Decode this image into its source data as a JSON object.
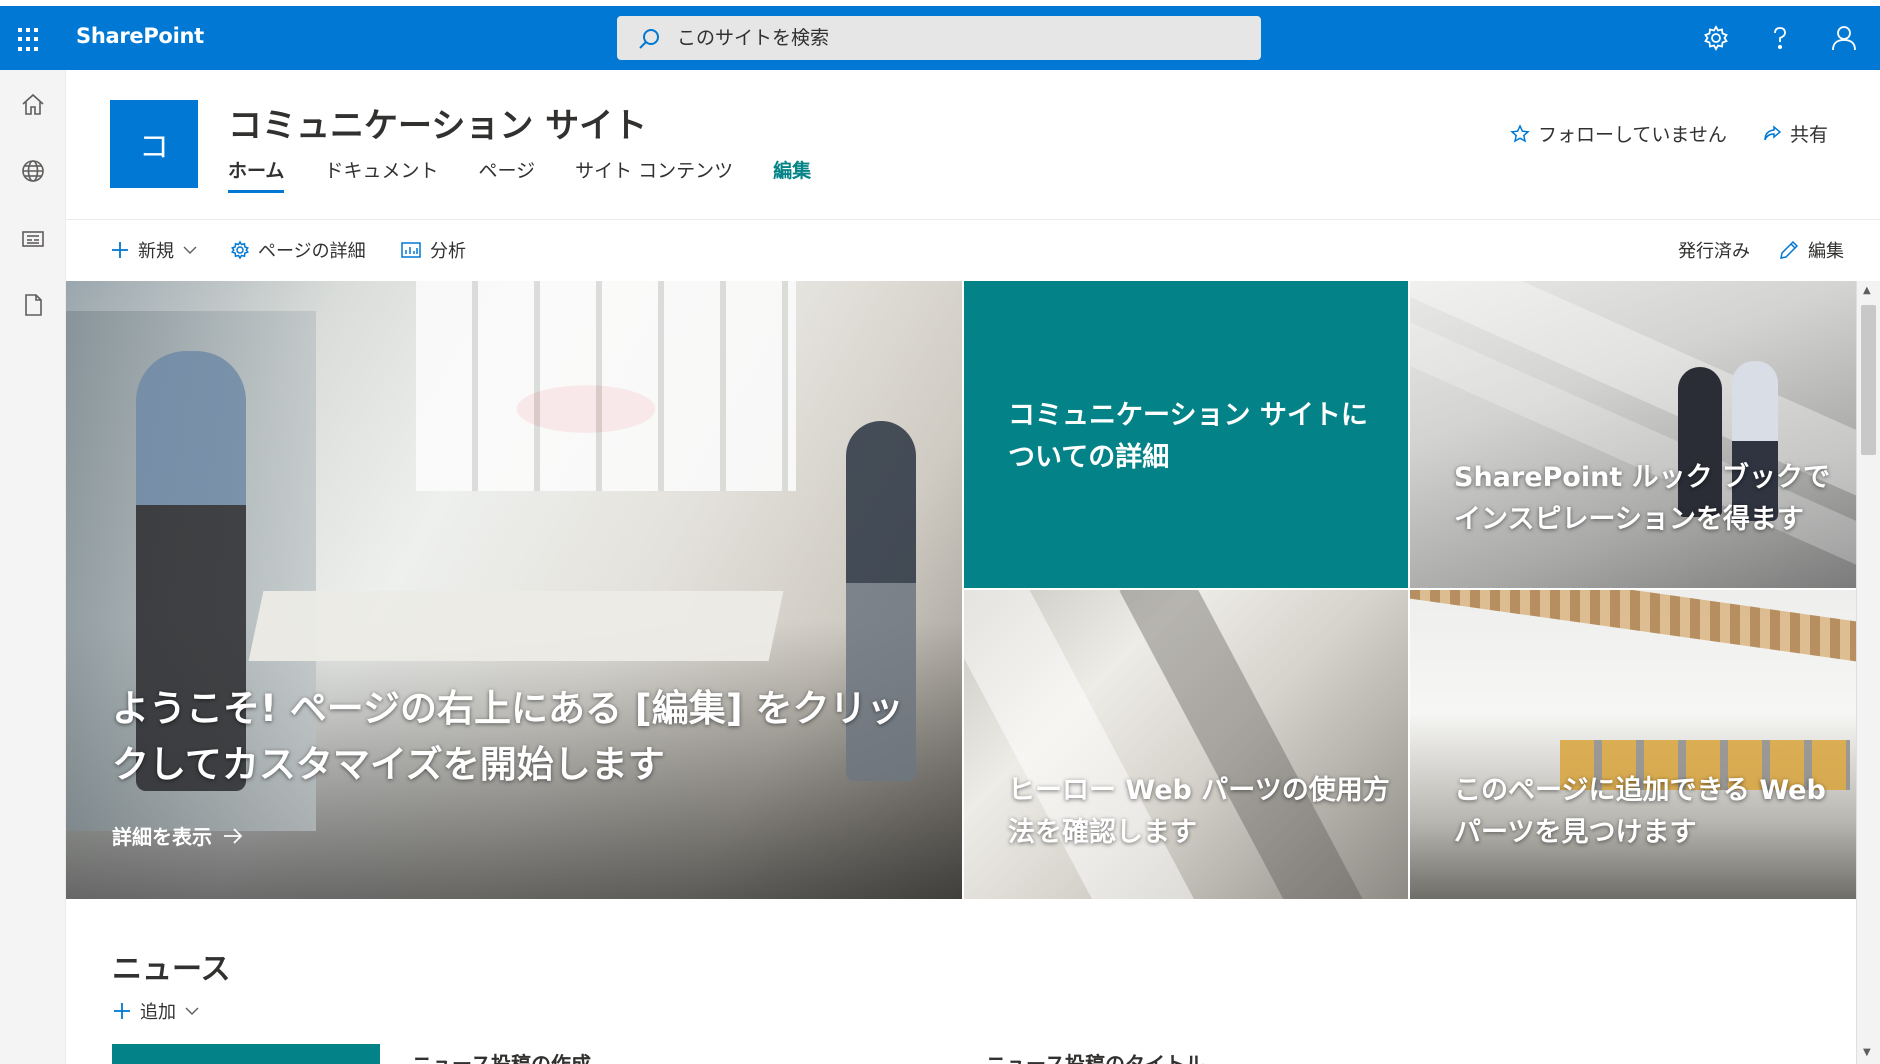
{
  "suitebar": {
    "brand": "SharePoint",
    "search_placeholder": "このサイトを検索",
    "bg_color": "#0078d4"
  },
  "left_rail": {
    "icons": [
      "home-icon",
      "globe-icon",
      "news-icon",
      "document-icon"
    ]
  },
  "site": {
    "logo_letter": "コ",
    "title": "コミュニケーション サイト",
    "nav": [
      {
        "label": "ホーム",
        "active": true
      },
      {
        "label": "ドキュメント"
      },
      {
        "label": "ページ"
      },
      {
        "label": "サイト コンテンツ"
      },
      {
        "label": "編集",
        "style": "edit"
      }
    ],
    "follow_label": "フォローしていません",
    "share_label": "共有"
  },
  "command_bar": {
    "new_label": "新規",
    "page_details_label": "ページの詳細",
    "analytics_label": "分析",
    "status_label": "発行済み",
    "edit_label": "編集"
  },
  "hero": {
    "main": {
      "title": "ようこそ! ページの右上にある [編集] をクリックしてカスタマイズを開始します",
      "link": "詳細を表示"
    },
    "tile_teal": {
      "title": "コミュニケーション サイトについての詳細",
      "color": "#038387"
    },
    "tile_top_right": {
      "title": "SharePoint ルック ブックでインスピレーションを得ます"
    },
    "tile_bottom_left": {
      "title": "ヒーロー Web パーツの使用方法を確認します"
    },
    "tile_bottom_right": {
      "title": "このページに追加できる Web パーツを見つけます"
    }
  },
  "news": {
    "title": "ニュース",
    "add_label": "追加",
    "items": [
      "ニュース投稿の作成",
      "ニュース投稿のタイトル"
    ]
  }
}
